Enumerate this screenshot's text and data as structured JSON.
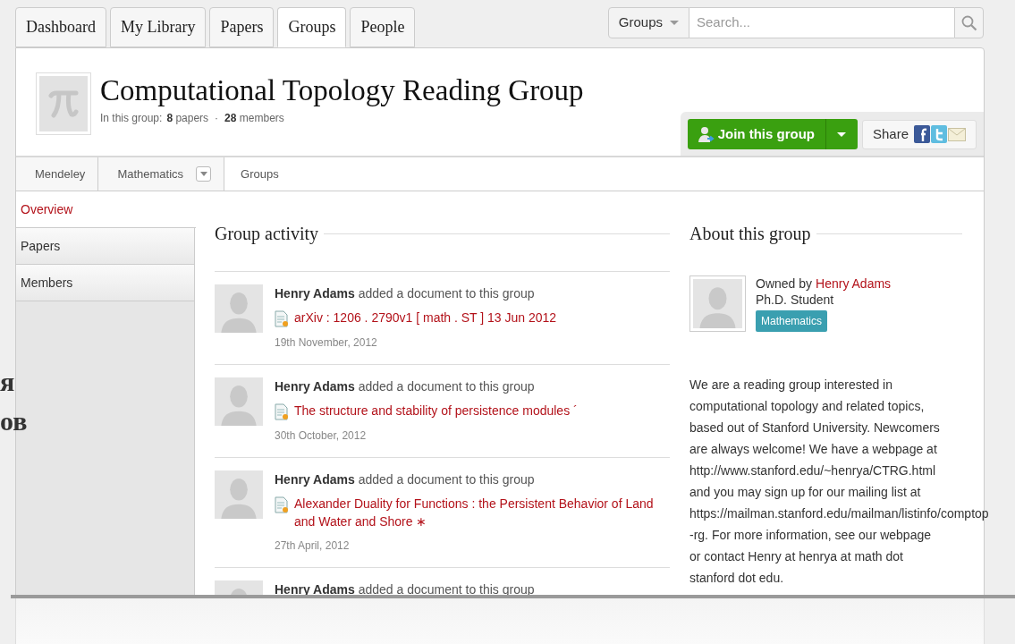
{
  "background_text": [
    "я",
    "ов"
  ],
  "tabs": [
    {
      "label": "Dashboard",
      "selected": false
    },
    {
      "label": "My Library",
      "selected": false
    },
    {
      "label": "Papers",
      "selected": false
    },
    {
      "label": "Groups",
      "selected": true
    },
    {
      "label": "People",
      "selected": false
    }
  ],
  "search": {
    "scope": "Groups",
    "placeholder": "Search..."
  },
  "group": {
    "title": "Computational Topology Reading Group",
    "stats_prefix": "In this group:",
    "papers_count": "8",
    "papers_label": "papers",
    "separator": "·",
    "members_count": "28",
    "members_label": "members"
  },
  "actions": {
    "join": "Join this group",
    "share": "Share"
  },
  "breadcrumb": [
    {
      "label": "Mendeley",
      "dropdown": false
    },
    {
      "label": "Mathematics",
      "dropdown": true
    },
    {
      "label": "Groups",
      "dropdown": false
    }
  ],
  "sidebar": [
    {
      "label": "Overview",
      "selected": true
    },
    {
      "label": "Papers",
      "selected": false
    },
    {
      "label": "Members",
      "selected": false
    }
  ],
  "activity": {
    "title": "Group activity",
    "items": [
      {
        "user": "Henry Adams",
        "action": "added a document to this group",
        "document": "arXiv : 1206 . 2790v1 [ math . ST ] 13 Jun 2012",
        "date": "19th November, 2012"
      },
      {
        "user": "Henry Adams",
        "action": "added a document to this group",
        "document": "The structure and stability of persistence modules ´",
        "date": "30th October, 2012"
      },
      {
        "user": "Henry Adams",
        "action": "added a document to this group",
        "document": "Alexander Duality for Functions : the Persistent Behavior of Land and Water and Shore ∗",
        "date": "27th April, 2012"
      },
      {
        "user": "Henry Adams",
        "action": "added a document to this group"
      }
    ]
  },
  "about": {
    "title": "About this group",
    "owned_prefix": "Owned by",
    "owner": "Henry Adams",
    "role": "Ph.D. Student",
    "tag": "Mathematics",
    "description": "We are a reading group interested in\ncomputational topology and related topics,\nbased out of Stanford University. Newcomers\nare always welcome! We have a webpage at\nhttp://www.stanford.edu/~henrya/CTRG.html\nand you may sign up for our mailing list at\nhttps://mailman.stanford.edu/mailman/listinfo/comptop\n-rg. For more information, see our webpage\nor contact Henry at henrya at math dot\nstanford dot edu."
  }
}
